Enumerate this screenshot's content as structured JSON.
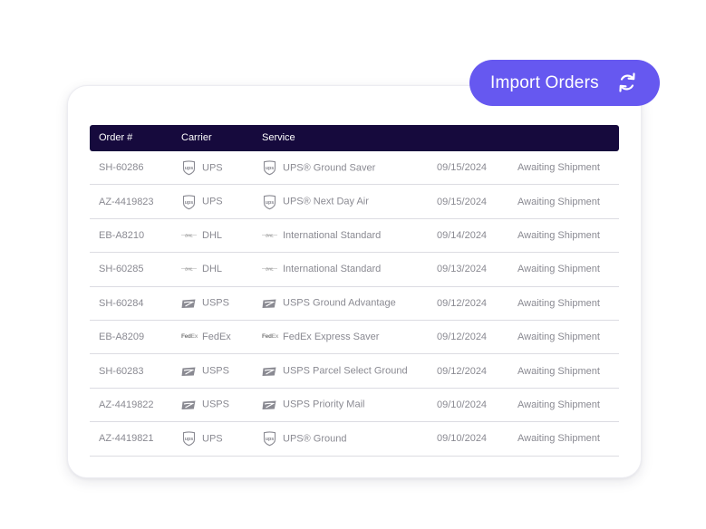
{
  "import_button": {
    "label": "Import Orders",
    "icon": "refresh-icon",
    "color": "#6658f0"
  },
  "table": {
    "header_color": "#160a3d",
    "columns": [
      "Order #",
      "Carrier",
      "Service"
    ],
    "rows": [
      {
        "order": "SH-60286",
        "carrier": "UPS",
        "carrier_icon": "ups-logo-icon",
        "service": "UPS® Ground Saver",
        "date": "09/15/2024",
        "status": "Awaiting Shipment"
      },
      {
        "order": "AZ-4419823",
        "carrier": "UPS",
        "carrier_icon": "ups-logo-icon",
        "service": "UPS® Next Day Air",
        "date": "09/15/2024",
        "status": "Awaiting Shipment"
      },
      {
        "order": "EB-A8210",
        "carrier": "DHL",
        "carrier_icon": "dhl-logo-icon",
        "service": "International Standard",
        "date": "09/14/2024",
        "status": "Awaiting Shipment"
      },
      {
        "order": "SH-60285",
        "carrier": "DHL",
        "carrier_icon": "dhl-logo-icon",
        "service": "International Standard",
        "date": "09/13/2024",
        "status": "Awaiting Shipment"
      },
      {
        "order": "SH-60284",
        "carrier": "USPS",
        "carrier_icon": "usps-logo-icon",
        "service": "USPS Ground Advantage",
        "date": "09/12/2024",
        "status": "Awaiting Shipment"
      },
      {
        "order": "EB-A8209",
        "carrier": "FedEx",
        "carrier_icon": "fedex-logo-icon",
        "service": "FedEx Express Saver",
        "date": "09/12/2024",
        "status": "Awaiting Shipment"
      },
      {
        "order": "SH-60283",
        "carrier": "USPS",
        "carrier_icon": "usps-logo-icon",
        "service": "USPS Parcel Select Ground",
        "date": "09/12/2024",
        "status": "Awaiting Shipment"
      },
      {
        "order": "AZ-4419822",
        "carrier": "USPS",
        "carrier_icon": "usps-logo-icon",
        "service": "USPS Priority Mail",
        "date": "09/10/2024",
        "status": "Awaiting Shipment"
      },
      {
        "order": "AZ-4419821",
        "carrier": "UPS",
        "carrier_icon": "ups-logo-icon",
        "service": "UPS® Ground",
        "date": "09/10/2024",
        "status": "Awaiting Shipment"
      }
    ]
  }
}
